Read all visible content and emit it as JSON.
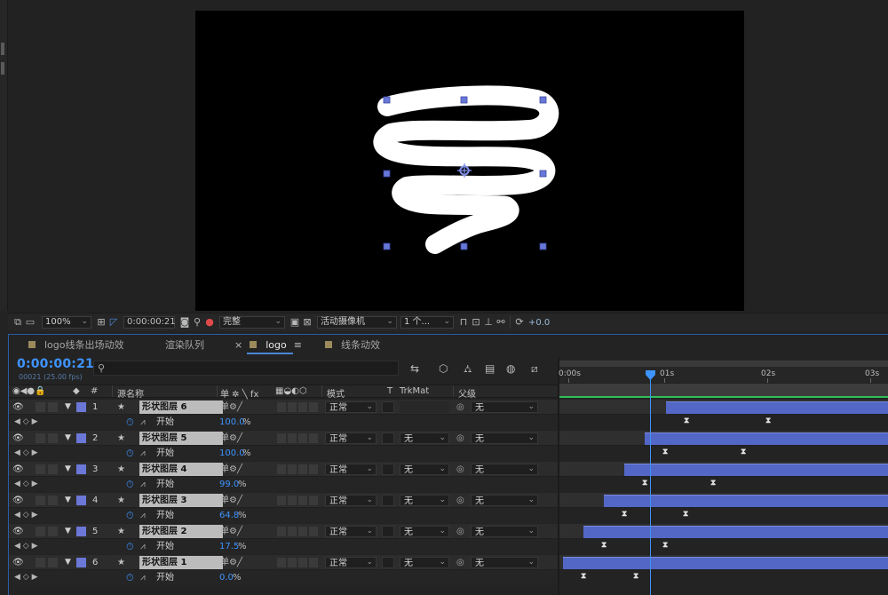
{
  "viewer": {
    "toolbar": {
      "zoom": "100%",
      "timecode": "0:00:00:21",
      "resolution": "完整",
      "camera": "活动摄像机",
      "views": "1 个...",
      "exposure": "+0.0"
    }
  },
  "panel": {
    "tabs": [
      {
        "label": "logo线条出场动效",
        "active": false
      },
      {
        "label": "渲染队列",
        "active": false
      },
      {
        "label": "logo",
        "active": true
      },
      {
        "label": "线条动效",
        "active": false
      }
    ],
    "tab_close": "×",
    "tab_menu": "≡"
  },
  "timeline": {
    "current_time": "0:00:00:21",
    "fps_info": "00021 (25.00 fps)",
    "search_placeholder": "",
    "columns": {
      "num": "#",
      "source_name": "源名称",
      "switches": "单 ✲ ╲ fx",
      "mode": "模式",
      "t": "T",
      "trkmat": "TrkMat",
      "parent": "父级"
    },
    "ruler": [
      "0:00s",
      "01s",
      "02s",
      "03s"
    ],
    "layers": [
      {
        "index": "1",
        "name": "形状图层 6",
        "mode": "正常",
        "trkmat": "",
        "parent": "无",
        "prop_name": "开始",
        "prop_value": "100.0",
        "prop_unit": "%"
      },
      {
        "index": "2",
        "name": "形状图层 5",
        "mode": "正常",
        "trkmat": "无",
        "parent": "无",
        "prop_name": "开始",
        "prop_value": "100.0",
        "prop_unit": "%"
      },
      {
        "index": "3",
        "name": "形状图层 4",
        "mode": "正常",
        "trkmat": "无",
        "parent": "无",
        "prop_name": "开始",
        "prop_value": "99.0",
        "prop_unit": "%"
      },
      {
        "index": "4",
        "name": "形状图层 3",
        "mode": "正常",
        "trkmat": "无",
        "parent": "无",
        "prop_name": "开始",
        "prop_value": "64.8",
        "prop_unit": "%"
      },
      {
        "index": "5",
        "name": "形状图层 2",
        "mode": "正常",
        "trkmat": "无",
        "parent": "无",
        "prop_name": "开始",
        "prop_value": "17.5",
        "prop_unit": "%"
      },
      {
        "index": "6",
        "name": "形状图层 1",
        "mode": "正常",
        "trkmat": "无",
        "parent": "无",
        "prop_name": "开始",
        "prop_value": "0.0",
        "prop_unit": "%"
      }
    ]
  },
  "colors": {
    "accent": "#3e94ff",
    "label_color": "#6b78d8",
    "layer_bar": "#5367c6",
    "work_area_line": "#2fbf5a"
  }
}
